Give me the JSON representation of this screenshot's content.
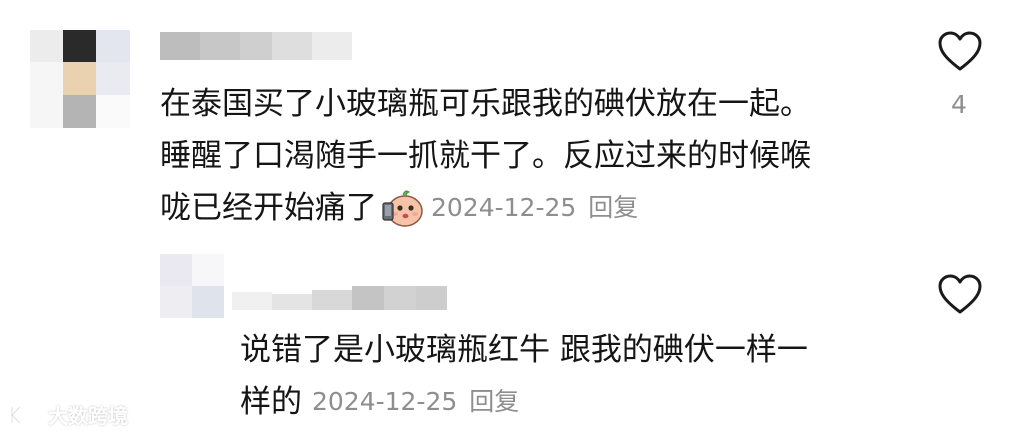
{
  "comments": [
    {
      "text_lines": [
        "在泰国买了小玻璃瓶可乐跟我的碘伏放在一起。",
        "睡醒了口渴随手一抓就干了。反应过来的时候喉",
        "咙已经开始痛了"
      ],
      "emoji": "sticker-face-holding-phone",
      "date": "2024-12-25",
      "reply_label": "回复",
      "likes": "4",
      "like_icon": "heart-outline-icon"
    },
    {
      "text_lines": [
        "说错了是小玻璃瓶红牛 跟我的碘伏一样一",
        "样的"
      ],
      "date": "2024-12-25",
      "reply_label": "回复",
      "like_icon": "heart-outline-icon"
    }
  ],
  "watermark": {
    "text": "大数跨境"
  },
  "colors": {
    "text": "#151515",
    "meta": "#8e8e8e",
    "icon": "#1a1a1a"
  }
}
